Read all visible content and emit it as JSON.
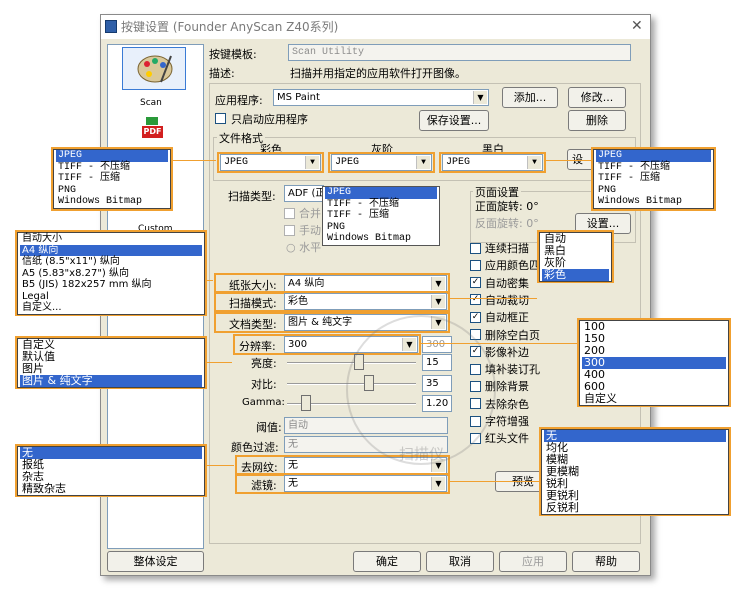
{
  "window": {
    "title": "按键设置 (Founder AnyScan Z40系列)"
  },
  "sidebar": {
    "items": [
      {
        "label": "Scan"
      },
      {
        "label": "Custom"
      }
    ]
  },
  "header": {
    "template_label": "按键模板:",
    "template_value": "Scan Utility",
    "desc_label": "描述:",
    "desc_value": "扫描并用指定的应用软件打开图像。"
  },
  "app": {
    "label": "应用程序:",
    "value": "MS Paint",
    "add": "添加...",
    "modify": "修改...",
    "delete": "删除",
    "only_start": "只启动应用程序",
    "save_settings": "保存设置..."
  },
  "file_format": {
    "group": "文件格式",
    "color_label": "彩色",
    "gray_label": "灰阶",
    "bw_label": "黑白",
    "color_value": "JPEG",
    "gray_value": "JPEG",
    "bw_value": "JPEG",
    "settings": "设置..."
  },
  "scan_type": {
    "label": "扫描类型:",
    "value": "ADF (正",
    "merge_label": "合并",
    "manual_label": "手动",
    "horizontal_label": "水平"
  },
  "page_settings": {
    "group": "页面设置",
    "front_label": "正面旋转: 0°",
    "back_label": "反面旋转: 0°",
    "settings": "设置..."
  },
  "paper_size": {
    "label": "纸张大小:",
    "value": "A4 纵向"
  },
  "scan_mode": {
    "label": "扫描模式:",
    "value": "彩色"
  },
  "doc_type": {
    "label": "文档类型:",
    "value": "图片 & 纯文字"
  },
  "resolution": {
    "label": "分辨率:",
    "value": "300",
    "spin": "300"
  },
  "brightness": {
    "label": "亮度:",
    "value": "15",
    "level": 0.56
  },
  "contrast": {
    "label": "对比:",
    "value": "35",
    "level": 0.65
  },
  "gamma": {
    "label": "Gamma:",
    "value": "1.20",
    "level": 0.12
  },
  "threshold": {
    "label": "阈值:",
    "value": "自动"
  },
  "color_filter": {
    "label": "颜色过滤:",
    "value": "无"
  },
  "descreen": {
    "label": "去网纹:",
    "value": "无"
  },
  "filter": {
    "label": "滤镜:",
    "value": "无"
  },
  "checks": [
    {
      "label": "连续扫描",
      "checked": false,
      "disabled": false
    },
    {
      "label": "应用颜色匹",
      "checked": false,
      "disabled": false
    },
    {
      "label": "自动密集",
      "checked": true,
      "disabled": false
    },
    {
      "label": "自动裁切",
      "checked": true,
      "disabled": false
    },
    {
      "label": "自动框正",
      "checked": true,
      "disabled": false
    },
    {
      "label": "删除空白页",
      "checked": false,
      "disabled": false
    },
    {
      "label": "影像补边",
      "checked": true,
      "disabled": false
    },
    {
      "label": "填补装订孔",
      "checked": false,
      "disabled": false
    },
    {
      "label": "删除背景",
      "checked": false,
      "disabled": false
    },
    {
      "label": "去除杂色",
      "checked": false,
      "disabled": false
    },
    {
      "label": "字符增强",
      "checked": false,
      "disabled": false
    },
    {
      "label": "红头文件",
      "checked": false,
      "disabled": false
    }
  ],
  "preview": "预览",
  "footer": {
    "all_settings": "整体设定",
    "ok": "确定",
    "cancel": "取消",
    "apply": "应用",
    "help": "帮助"
  },
  "popups": {
    "color_format": {
      "items": [
        "JPEG",
        "TIFF - 不压缩",
        "TIFF - 压缩",
        "PNG",
        "Windows Bitmap"
      ],
      "selected": 0
    },
    "gray_format": {
      "items": [
        "JPEG",
        "TIFF - 不压缩",
        "TIFF - 压缩",
        "PNG",
        "Windows Bitmap"
      ],
      "selected": 0
    },
    "bw_format": {
      "items": [
        "JPEG",
        "TIFF - 不压缩",
        "TIFF - 压缩",
        "PNG",
        "Windows Bitmap"
      ],
      "selected": 0
    },
    "paper_size": {
      "items": [
        "自动大小",
        "A4 纵向",
        "信纸 (8.5\"x11\") 纵向",
        "A5 (5.83\"x8.27\") 纵向",
        "B5 (JIS) 182x257 mm 纵向",
        "Legal",
        "自定义..."
      ],
      "selected": 1
    },
    "scan_mode": {
      "items": [
        "自动",
        "黑白",
        "灰阶",
        "彩色"
      ],
      "selected": 3
    },
    "doc_type": {
      "items": [
        "自定义",
        "默认值",
        "图片",
        "图片 & 纯文字"
      ],
      "selected": 3
    },
    "resolution": {
      "items": [
        "100",
        "150",
        "200",
        "300",
        "400",
        "600",
        "自定义"
      ],
      "selected": 3
    },
    "descreen": {
      "items": [
        "无",
        "报纸",
        "杂志",
        "精致杂志"
      ],
      "selected": 0
    },
    "filter": {
      "items": [
        "无",
        "均化",
        "模糊",
        "更模糊",
        "锐利",
        "更锐利",
        "反锐利"
      ],
      "selected": 0
    }
  },
  "watermark": {
    "text": "扫描仪"
  },
  "colors": {
    "accent": "#f0a030",
    "selection": "#3366cc",
    "dialog": "#ece9d8"
  }
}
